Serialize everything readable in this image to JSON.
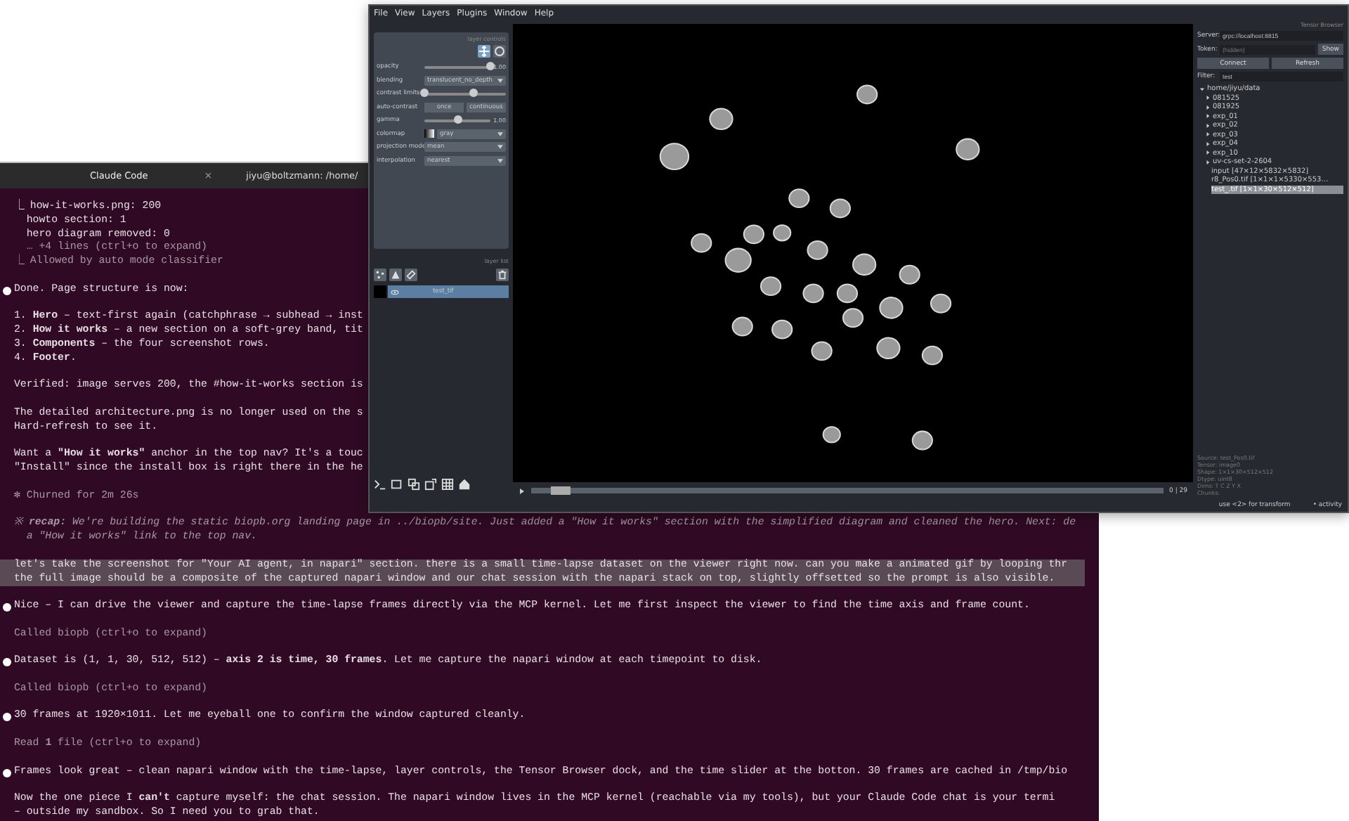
{
  "terminal": {
    "tabs": [
      {
        "label": "Claude Code",
        "selected": true,
        "closable": true,
        "close": "×"
      },
      {
        "label": "jiyu@boltzmann: /home/",
        "selected": false,
        "closable": false
      }
    ],
    "blocks": [
      {
        "kind": "output",
        "lines": [
          {
            "text": "⎿ how-it-works.png: 200",
            "dim": false
          },
          {
            "text": "  howto section: 1",
            "dim": false
          },
          {
            "text": "  hero diagram removed: 0",
            "dim": false
          },
          {
            "text": "  … +4 lines (ctrl+o to expand)",
            "dim": true
          },
          {
            "text": "⎿ Allowed by auto mode classifier",
            "dim": true
          }
        ]
      },
      {
        "kind": "message",
        "bullet": true,
        "lines": [
          {
            "text": "Done. Page structure is now:",
            "dim": false
          }
        ]
      },
      {
        "kind": "message",
        "bullet": false,
        "lines": [
          {
            "text": "1. **Hero** – text-first again (catchphrase → subhead → inst",
            "dim": false
          },
          {
            "text": "2. **How it works** – a new section on a soft-grey band, tit",
            "dim": false
          },
          {
            "text": "3. **Components** – the four screenshot rows.",
            "dim": false
          },
          {
            "text": "4. **Footer**.",
            "dim": false
          }
        ]
      },
      {
        "kind": "message",
        "bullet": false,
        "lines": [
          {
            "text": "Verified: image serves 200, the #how-it-works section is",
            "dim": false
          }
        ]
      },
      {
        "kind": "message",
        "bullet": false,
        "lines": [
          {
            "text": "The detailed architecture.png is no longer used on the s",
            "dim": false
          },
          {
            "text": "Hard-refresh to see it.",
            "dim": false
          }
        ]
      },
      {
        "kind": "message",
        "bullet": false,
        "lines": [
          {
            "text": "Want a **\"How it works\"** anchor in the top nav? It's a touc",
            "dim": false
          },
          {
            "text": "\"Install\" since the install box is right there in the he",
            "dim": false
          }
        ]
      },
      {
        "kind": "status",
        "lines": [
          {
            "text": "✻ Churned for 2m 26s",
            "dim": true
          }
        ]
      },
      {
        "kind": "recap",
        "lines": [
          {
            "text": "※ **recap:** We're building the static biopb.org landing page in ../biopb/site. Just added a \"How it works\" section with the simplified diagram and cleaned the hero. Next: de",
            "dim": true
          },
          {
            "text": "  a \"How it works\" link to the top nav.",
            "dim": true
          }
        ]
      },
      {
        "kind": "prompt",
        "lines": [
          {
            "text": "let's take the screenshot for \"Your AI agent, in napari\" section. there is a small time-lapse dataset on the viewer right now. can you make a animated gif by looping thr",
            "dim": false
          },
          {
            "text": "the full image should be a composite of the captured napari window and our chat session with the napari stack on top, slightly offsetted so the prompt is also visible.",
            "dim": false
          }
        ]
      },
      {
        "kind": "message",
        "bullet": true,
        "lines": [
          {
            "text": "Nice – I can drive the viewer and capture the time-lapse frames directly via the MCP kernel. Let me first inspect the viewer to find the time axis and frame count.",
            "dim": false
          }
        ]
      },
      {
        "kind": "message",
        "bullet": false,
        "lines": [
          {
            "text": "Called biopb (ctrl+o to expand)",
            "dim": true
          }
        ]
      },
      {
        "kind": "message",
        "bullet": true,
        "lines": [
          {
            "text": "Dataset is (1, 1, 30, 512, 512) – **axis 2 is time, 30 frames**. Let me capture the napari window at each timepoint to disk.",
            "dim": false
          }
        ]
      },
      {
        "kind": "message",
        "bullet": false,
        "lines": [
          {
            "text": "Called biopb (ctrl+o to expand)",
            "dim": true
          }
        ]
      },
      {
        "kind": "message",
        "bullet": true,
        "lines": [
          {
            "text": "30 frames at 1920×1011. Let me eyeball one to confirm the window captured cleanly.",
            "dim": false
          }
        ]
      },
      {
        "kind": "message",
        "bullet": false,
        "lines": [
          {
            "text": "Read **1** file (ctrl+o to expand)",
            "dim": true
          }
        ]
      },
      {
        "kind": "message",
        "bullet": true,
        "lines": [
          {
            "text": "Frames look great – clean napari window with the time-lapse, layer controls, the Tensor Browser dock, and the time slider at the botton. 30 frames are cached in /tmp/bio",
            "dim": false
          }
        ]
      },
      {
        "kind": "message",
        "bullet": false,
        "lines": [
          {
            "text": "Now the one piece I **can't** capture myself: the chat session. The napari window lives in the MCP kernel (reachable via my tools), but your Claude Code chat is your termi",
            "dim": false
          },
          {
            "text": "– outside my sandbox. So I need you to grab that.",
            "dim": false
          }
        ]
      }
    ]
  },
  "napari": {
    "menu": [
      "File",
      "View",
      "Layers",
      "Plugins",
      "Window",
      "Help"
    ],
    "layer_controls": {
      "title": "layer controls",
      "rows": [
        {
          "label": "opacity",
          "kind": "slider",
          "level": 1,
          "reading": "1.00"
        },
        {
          "label": "blending",
          "kind": "select",
          "value": "translucent_no_depth"
        },
        {
          "label": "contrast limits",
          "kind": "range",
          "level": 0.6
        },
        {
          "label": "auto-contrast",
          "kind": "buttons",
          "buttons": [
            "once",
            "continuous"
          ]
        },
        {
          "label": "gamma",
          "kind": "slider",
          "level": 0.5,
          "reading": "1.00"
        },
        {
          "label": "colormap",
          "kind": "colormap",
          "value": "gray"
        },
        {
          "label": "projection mode",
          "kind": "select",
          "value": "mean"
        },
        {
          "label": "interpolation",
          "kind": "select",
          "value": "nearest"
        }
      ]
    },
    "layer_list": {
      "title": "layer list",
      "layers": [
        {
          "name": "test_tif",
          "selected": true,
          "visible": true
        }
      ]
    },
    "dims": {
      "level": 0.03,
      "reading": "0 | 29"
    },
    "browser": {
      "title": "Tensor Browser",
      "server_label": "Server:",
      "token_label": "Token:",
      "filter_label": "Filter:",
      "server": "grpc://localhost:8815",
      "token_placeholder": "(hidden)",
      "show": "Show",
      "connect": "Connect",
      "refresh": "Refresh",
      "filter": "test",
      "tree": [
        {
          "label": "home/jiyu/data",
          "kind": "folder",
          "expanded": true,
          "selected": false,
          "children": [
            {
              "label": "081525",
              "kind": "folder",
              "expanded": false,
              "selected": false
            },
            {
              "label": "081925",
              "kind": "folder",
              "expanded": false,
              "selected": false
            },
            {
              "label": "exp_01",
              "kind": "folder",
              "expanded": false,
              "selected": false
            },
            {
              "label": "exp_02",
              "kind": "folder",
              "expanded": false,
              "selected": false
            },
            {
              "label": "exp_03",
              "kind": "folder",
              "expanded": false,
              "selected": false
            },
            {
              "label": "exp_04",
              "kind": "folder",
              "expanded": false,
              "selected": false
            },
            {
              "label": "exp_10",
              "kind": "folder",
              "expanded": false,
              "selected": false
            },
            {
              "label": "uv-cs-set-2-2604",
              "kind": "folder",
              "expanded": false,
              "selected": false
            },
            {
              "label": "input  [47×12×5832×5832]",
              "kind": "file",
              "selected": false
            },
            {
              "label": "r8_Pos0.tif  [1×1×1×5330×553…",
              "kind": "file",
              "selected": false
            },
            {
              "label": "test_.tif  [1×1×30×512×512]",
              "kind": "file",
              "selected": true
            }
          ]
        }
      ],
      "info": [
        "Source: test_Pos0.tif",
        "Tensor: image0",
        "Shape: 1×1×30×512×512",
        "Dtype: uint8",
        "Dims: T C Z Y X",
        "Chunks:"
      ]
    },
    "status": {
      "hint": "use <2> for transform",
      "activity": "• activity"
    }
  }
}
